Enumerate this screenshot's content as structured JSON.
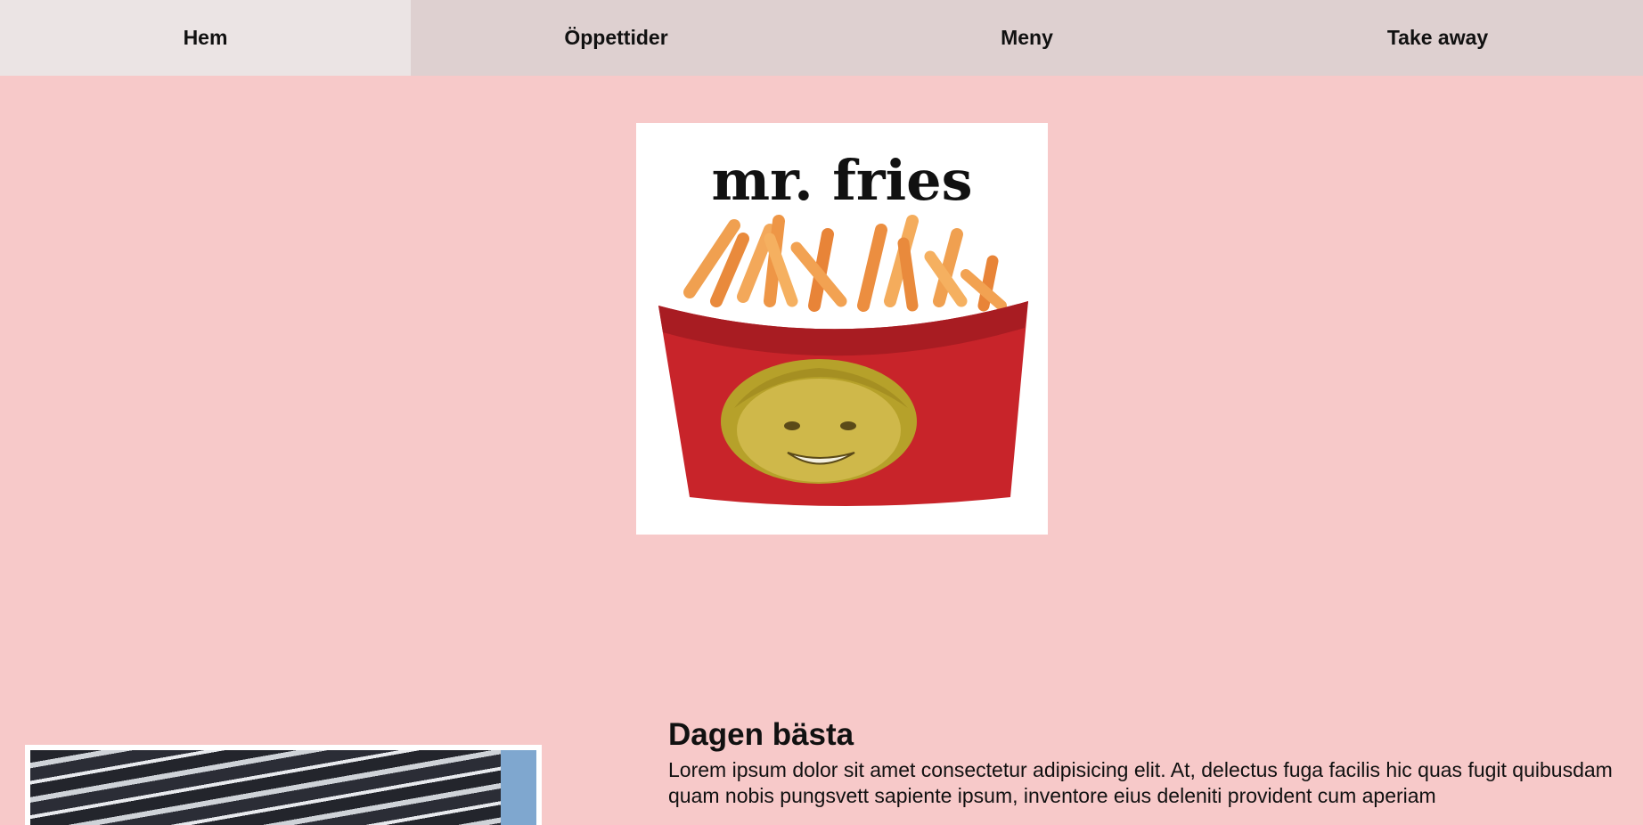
{
  "nav": {
    "items": [
      {
        "label": "Hem"
      },
      {
        "label": "Öppettider"
      },
      {
        "label": "Meny"
      },
      {
        "label": "Take away"
      }
    ]
  },
  "logo": {
    "text": "mr. fries"
  },
  "article": {
    "title": "Dagen bästa",
    "body": "Lorem ipsum dolor sit amet consectetur adipisicing elit. At, delectus fuga facilis hic quas fugit quibusdam quam nobis pungsvett sapiente ipsum, inventore eius deleniti provident cum aperiam"
  },
  "colors": {
    "background": "#f7c9c9",
    "nav": "#ded0d0",
    "nav_active": "#ebe4e4"
  }
}
